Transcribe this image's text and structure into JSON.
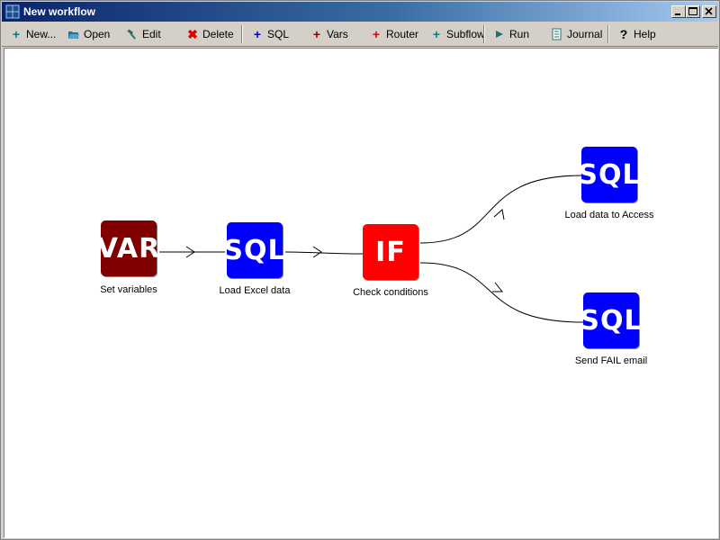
{
  "window": {
    "title": "New workflow"
  },
  "toolbar": {
    "new": "New...",
    "open": "Open",
    "edit": "Edit",
    "delete": "Delete",
    "sql": "SQL",
    "vars": "Vars",
    "router": "Router",
    "subflow": "Subflow",
    "run": "Run",
    "journal": "Journal",
    "help": "Help"
  },
  "nodes": {
    "var": {
      "text": "VAR",
      "label": "Set variables"
    },
    "sql1": {
      "text": "SQL",
      "label": "Load  Excel data"
    },
    "if": {
      "text": "IF",
      "label": "Check conditions"
    },
    "sql2": {
      "text": "SQL",
      "label": "Load data to Access"
    },
    "sql3": {
      "text": "SQL",
      "label": "Send FAIL email"
    }
  },
  "colors": {
    "var": "#800000",
    "sql": "#0000ff",
    "if": "#ff0000",
    "title_start": "#0a246a",
    "title_end": "#a6caf0"
  }
}
